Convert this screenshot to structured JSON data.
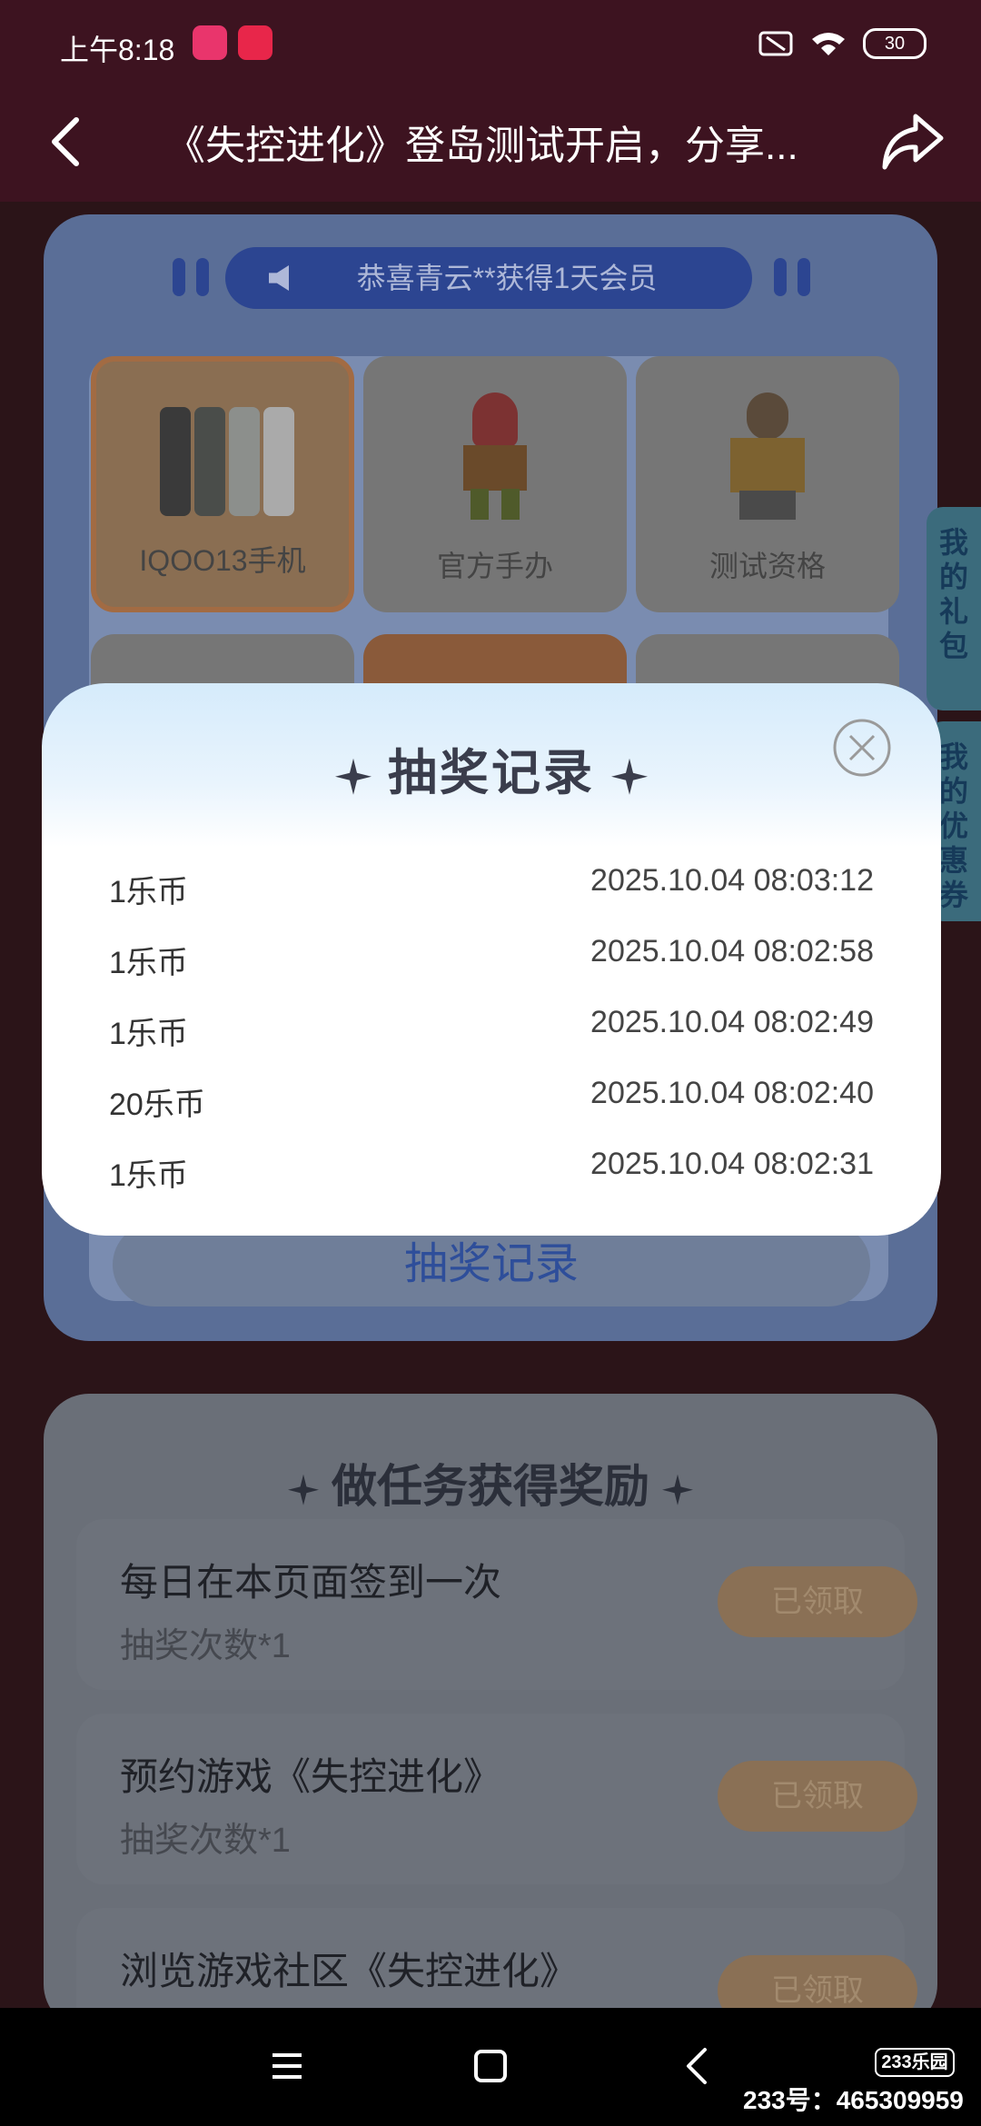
{
  "status_bar": {
    "time": "上午8:18",
    "battery": "30"
  },
  "header": {
    "title": "《失控进化》登岛测试开启，分享..."
  },
  "marquee": {
    "text": "恭喜青云**获得1天会员"
  },
  "prizes": [
    {
      "label": "IQOO13手机"
    },
    {
      "label": "官方手办"
    },
    {
      "label": "测试资格"
    }
  ],
  "side_tabs": {
    "gift": "我的礼包",
    "coupon": "我的优惠券"
  },
  "lottery_record_button": "抽奖记录",
  "modal": {
    "title": "抽奖记录",
    "records": [
      {
        "prize": "1乐币",
        "time": "2025.10.04 08:03:12"
      },
      {
        "prize": "1乐币",
        "time": "2025.10.04 08:02:58"
      },
      {
        "prize": "1乐币",
        "time": "2025.10.04 08:02:49"
      },
      {
        "prize": "20乐币",
        "time": "2025.10.04 08:02:40"
      },
      {
        "prize": "1乐币",
        "time": "2025.10.04 08:02:31"
      }
    ]
  },
  "tasks": {
    "title": "做任务获得奖励",
    "items": [
      {
        "name": "每日在本页面签到一次",
        "reward": "抽奖次数*1",
        "button": "已领取"
      },
      {
        "name": "预约游戏《失控进化》",
        "reward": "抽奖次数*1",
        "button": "已领取"
      },
      {
        "name": "浏览游戏社区《失控进化》",
        "reward": "",
        "button": "已领取"
      }
    ]
  },
  "watermark": {
    "logo": "233乐园",
    "id": "233号：465309959"
  }
}
